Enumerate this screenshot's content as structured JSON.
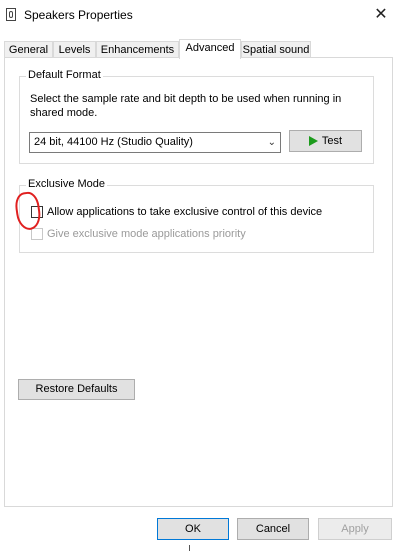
{
  "window": {
    "title": "Speakers Properties",
    "close_glyph": "✕"
  },
  "tabs": [
    {
      "label": "General",
      "active": false
    },
    {
      "label": "Levels",
      "active": false
    },
    {
      "label": "Enhancements",
      "active": false
    },
    {
      "label": "Advanced",
      "active": true
    },
    {
      "label": "Spatial sound",
      "active": false
    }
  ],
  "default_format": {
    "group_title": "Default Format",
    "description": "Select the sample rate and bit depth to be used when running in shared mode.",
    "selected_format": "24 bit, 44100 Hz (Studio Quality)",
    "test_label": "Test"
  },
  "exclusive_mode": {
    "group_title": "Exclusive Mode",
    "allow_exclusive_label": "Allow applications to take exclusive control of this device",
    "allow_exclusive_checked": false,
    "priority_label": "Give exclusive mode applications priority",
    "priority_checked": false,
    "priority_enabled": false
  },
  "restore_defaults_label": "Restore Defaults",
  "footer": {
    "ok_label": "OK",
    "cancel_label": "Cancel",
    "apply_label": "Apply"
  },
  "colors": {
    "annotation": "#e02020",
    "test_icon": "#1c9b1c",
    "default_button_border": "#0078d7"
  }
}
